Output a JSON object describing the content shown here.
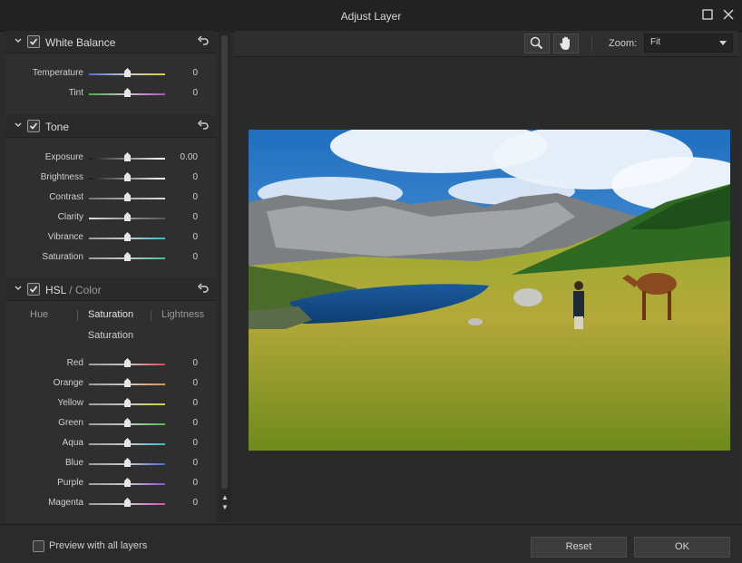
{
  "window": {
    "title": "Adjust Layer"
  },
  "white_balance": {
    "title": "White Balance",
    "rows": [
      {
        "label": "Temperature",
        "value": "0"
      },
      {
        "label": "Tint",
        "value": "0"
      }
    ]
  },
  "tone": {
    "title": "Tone",
    "rows": [
      {
        "label": "Exposure",
        "value": "0.00"
      },
      {
        "label": "Brightness",
        "value": "0"
      },
      {
        "label": "Contrast",
        "value": "0"
      },
      {
        "label": "Clarity",
        "value": "0"
      },
      {
        "label": "Vibrance",
        "value": "0"
      },
      {
        "label": "Saturation",
        "value": "0"
      }
    ]
  },
  "hsl": {
    "title": "HSL",
    "title_sep": "/",
    "title_alt": "Color",
    "tabs": [
      "Hue",
      "Saturation",
      "Lightness"
    ],
    "active_tab": "Saturation",
    "subtitle": "Saturation",
    "rows": [
      {
        "label": "Red",
        "value": "0"
      },
      {
        "label": "Orange",
        "value": "0"
      },
      {
        "label": "Yellow",
        "value": "0"
      },
      {
        "label": "Green",
        "value": "0"
      },
      {
        "label": "Aqua",
        "value": "0"
      },
      {
        "label": "Blue",
        "value": "0"
      },
      {
        "label": "Purple",
        "value": "0"
      },
      {
        "label": "Magenta",
        "value": "0"
      }
    ]
  },
  "toolbar": {
    "zoom_label": "Zoom:",
    "zoom_value": "Fit"
  },
  "footer": {
    "preview_label": "Preview with all layers",
    "reset_label": "Reset",
    "ok_label": "OK"
  },
  "icons": {
    "zoom_tool": "magnifier-icon",
    "pan_tool": "hand-icon",
    "maximize": "maximize-icon",
    "close": "close-icon"
  }
}
